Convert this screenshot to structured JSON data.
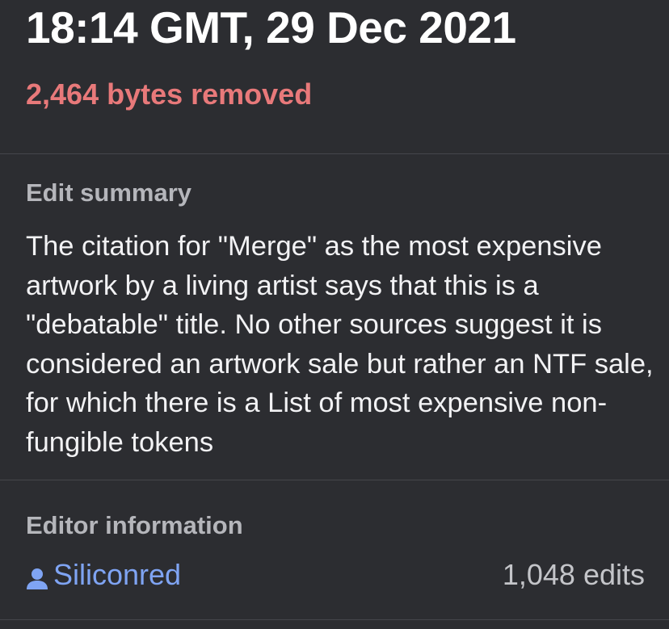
{
  "header": {
    "timestamp": "18:14 GMT, 29 Dec 2021",
    "bytes_change": "2,464 bytes removed"
  },
  "summary": {
    "title": "Edit summary",
    "text": "The citation for \"Merge\" as the most expensive artwork by a living artist says that this is a \"debatable\" title. No other sources suggest it is considered an artwork sale but rather an NTF sale, for which there is a List of most expensive non-fungible tokens"
  },
  "editor": {
    "title": "Editor information",
    "username": "Siliconred",
    "user_icon": "user-icon",
    "edit_count": "1,048 edits"
  },
  "colors": {
    "background": "#2c2d31",
    "bytes_removed": "#e8797a",
    "link": "#7fa4f3",
    "divider": "#45464b"
  }
}
